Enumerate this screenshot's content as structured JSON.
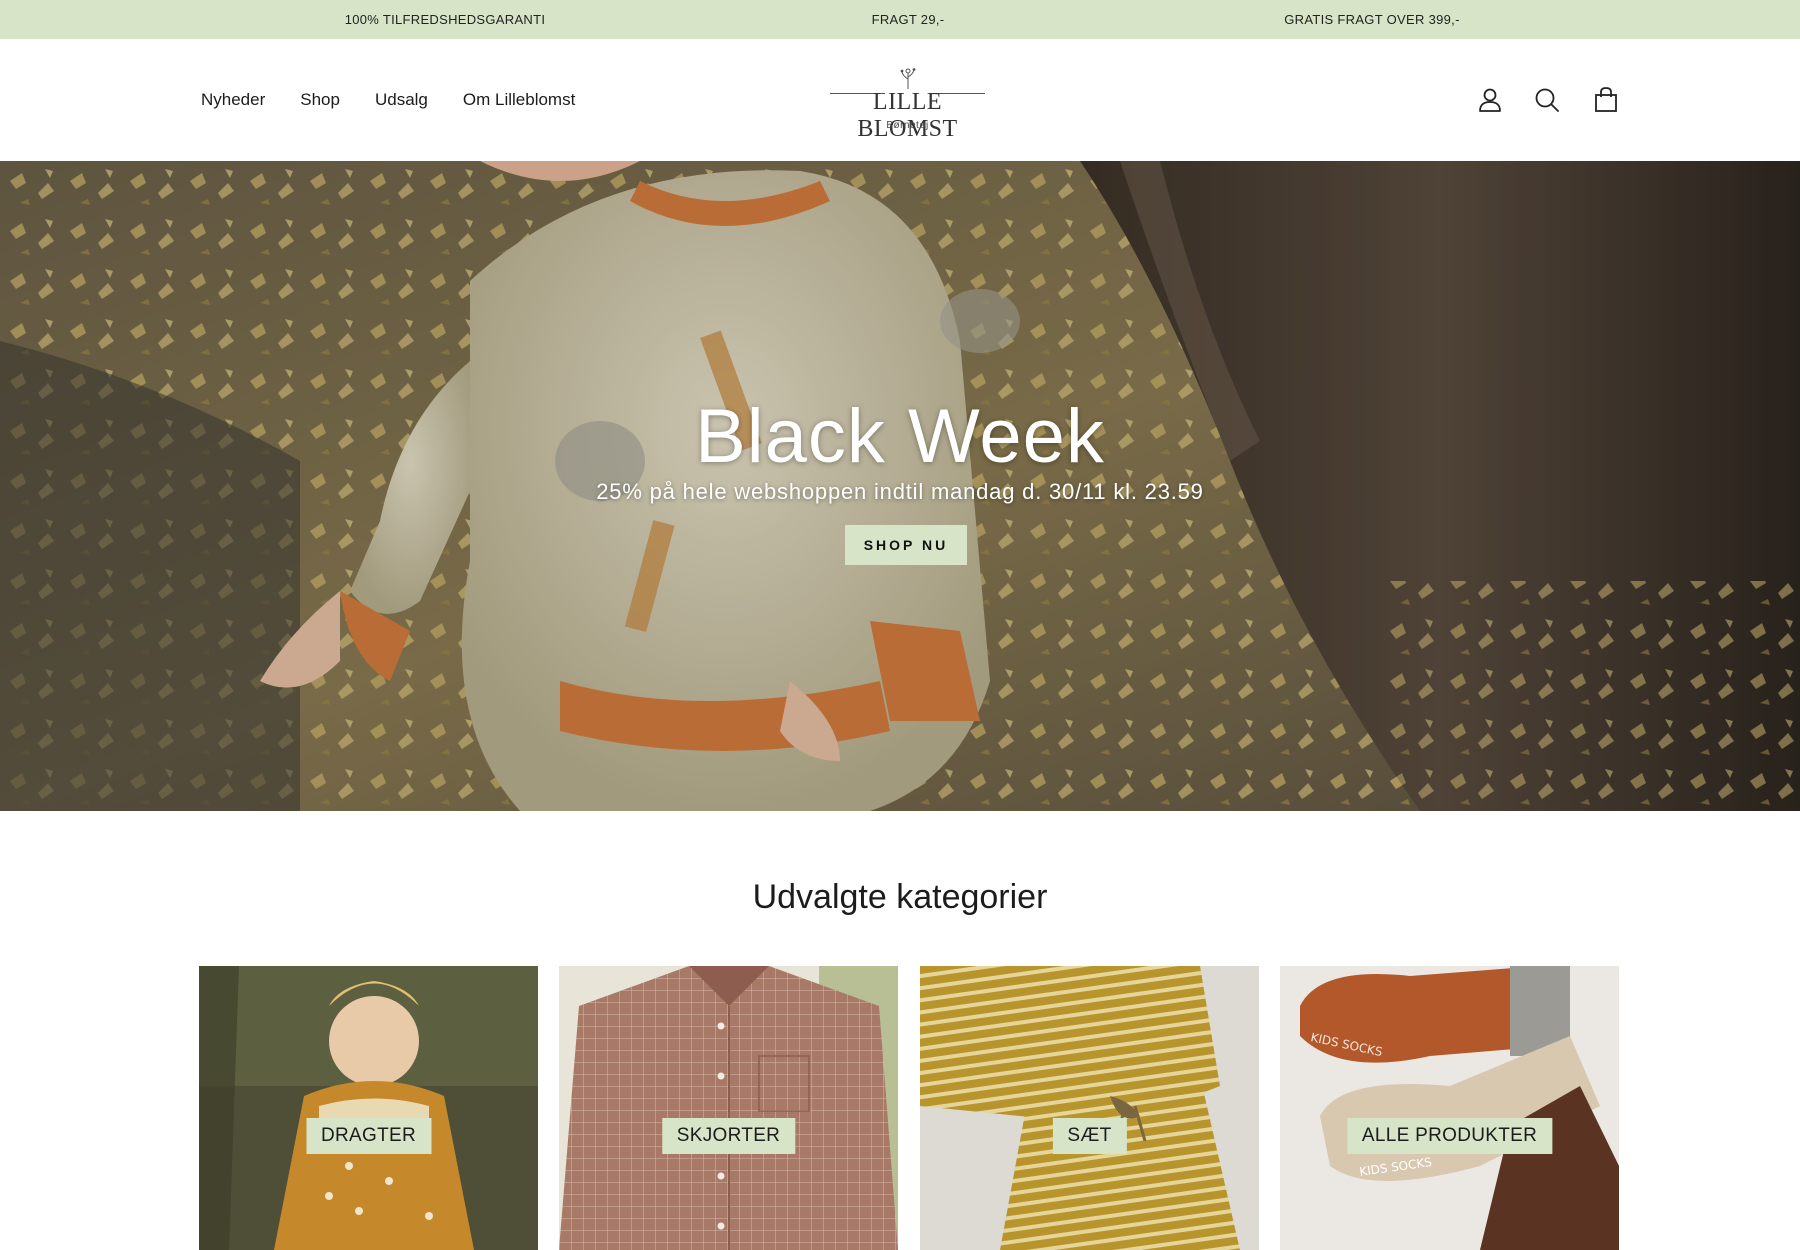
{
  "announcement": {
    "items": [
      "100% TILFREDSHEDSGARANTI",
      "FRAGT 29,-",
      "GRATIS FRAGT OVER 399,-"
    ],
    "background": "#d7e4c7"
  },
  "header": {
    "nav": [
      "Nyheder",
      "Shop",
      "Udsalg",
      "Om Lilleblomst"
    ],
    "logo": {
      "name": "LILLE BLOMST",
      "tagline": "Børnetøj"
    },
    "icons": [
      "account-icon",
      "search-icon",
      "cart-icon"
    ]
  },
  "hero": {
    "title": "Black Week",
    "subtitle": "25% på hele webshoppen indtil mandag d. 30/11 kl. 23.59",
    "cta": "SHOP NU"
  },
  "categories": {
    "title": "Udvalgte kategorier",
    "items": [
      {
        "label": "DRAGTER"
      },
      {
        "label": "SKJORTER"
      },
      {
        "label": "SÆT"
      },
      {
        "label": "ALLE PRODUKTER"
      }
    ]
  },
  "colors": {
    "accent": "#d7e4c7",
    "text": "#1c1c1c"
  }
}
